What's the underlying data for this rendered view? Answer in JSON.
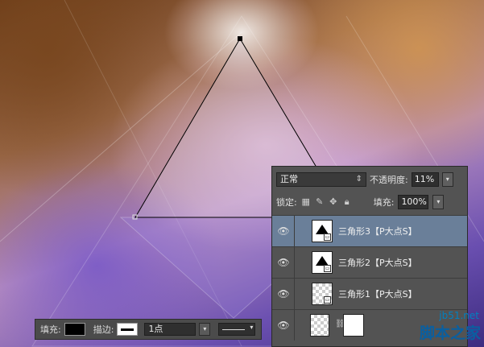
{
  "toolbar": {
    "fill_label": "填充:",
    "stroke_label": "描边:",
    "stroke_width": "1点",
    "dropdown_arrow": "▾"
  },
  "panel": {
    "blend_mode": "正常",
    "opacity_label": "不透明度:",
    "opacity_value": "11%",
    "lock_label": "锁定:",
    "fill_label": "填充:",
    "fill_value": "100%",
    "dropdown_arrow": "▾",
    "layers": [
      {
        "name": "三角形3【P大点S】",
        "selected": true,
        "thumb": "triangle-icon"
      },
      {
        "name": "三角形2【P大点S】",
        "selected": false,
        "thumb": "triangle-icon"
      },
      {
        "name": "三角形1【P大点S】",
        "selected": false,
        "thumb": "checker"
      },
      {
        "name": "",
        "selected": false,
        "thumb": "checker-with-mask"
      }
    ]
  },
  "watermark": {
    "url": "jb51.net",
    "name": "脚本之家"
  },
  "colors": {
    "panel_bg": "#535353",
    "selected_layer": "#6a7f99",
    "anchor_point": "#000000"
  }
}
